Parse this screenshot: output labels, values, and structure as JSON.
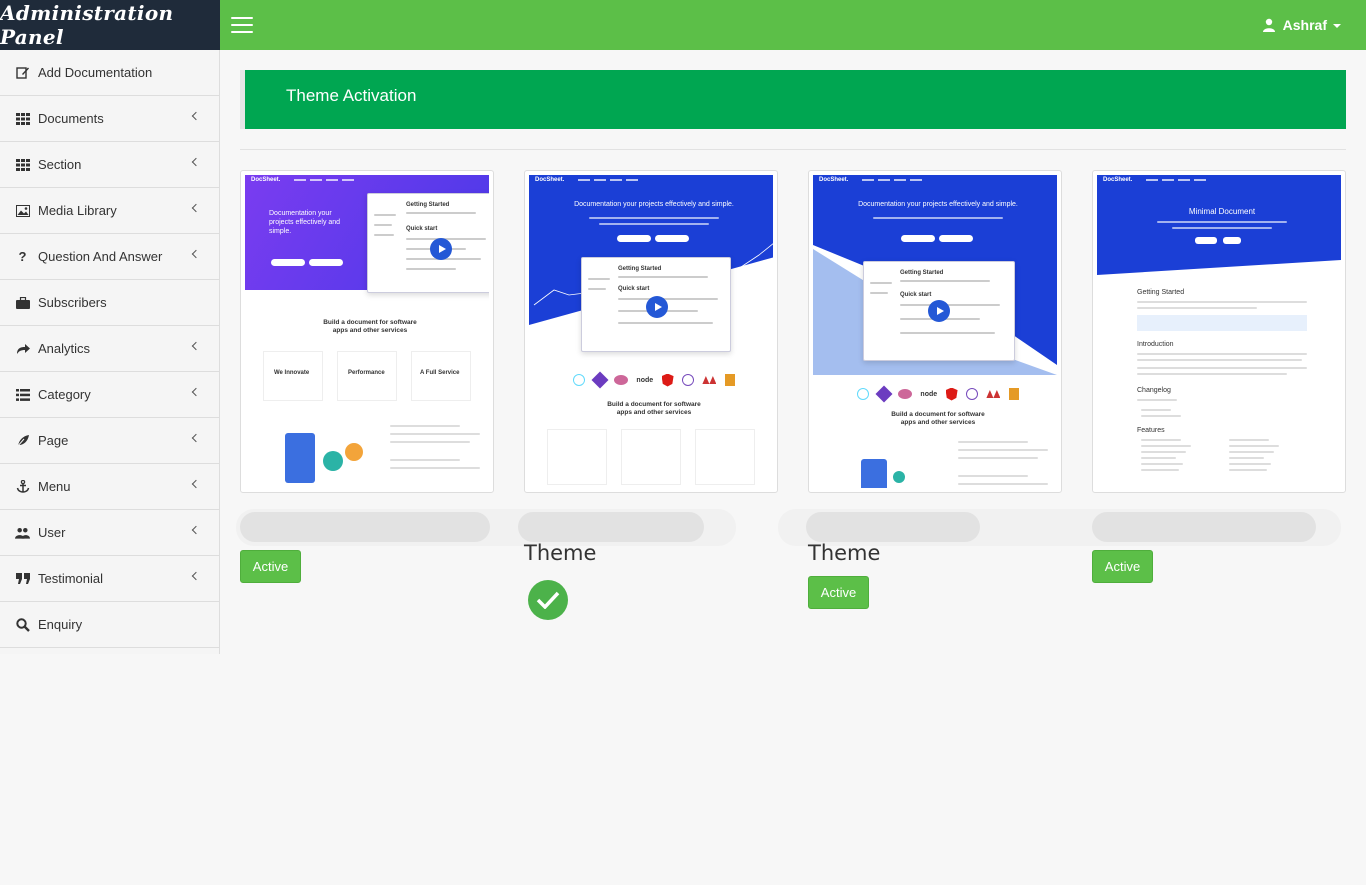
{
  "app": {
    "brand": "Administration Panel",
    "user": "Ashraf"
  },
  "sidebar": {
    "items": [
      {
        "label": "Add Documentation",
        "icon": "edit-icon",
        "submenu": false
      },
      {
        "label": "Documents",
        "icon": "grid-icon",
        "submenu": true
      },
      {
        "label": "Section",
        "icon": "grid-icon",
        "submenu": true
      },
      {
        "label": "Media Library",
        "icon": "image-icon",
        "submenu": true
      },
      {
        "label": "Question And Answer",
        "icon": "question-icon",
        "submenu": true
      },
      {
        "label": "Subscribers",
        "icon": "briefcase-icon",
        "submenu": false
      },
      {
        "label": "Analytics",
        "icon": "share-icon",
        "submenu": true
      },
      {
        "label": "Category",
        "icon": "list-icon",
        "submenu": true
      },
      {
        "label": "Page",
        "icon": "leaf-icon",
        "submenu": true
      },
      {
        "label": "Menu",
        "icon": "anchor-icon",
        "submenu": true
      },
      {
        "label": "User",
        "icon": "users-icon",
        "submenu": true
      },
      {
        "label": "Testimonial",
        "icon": "quote-icon",
        "submenu": true
      },
      {
        "label": "Enquiry",
        "icon": "search-icon",
        "submenu": false
      }
    ]
  },
  "main": {
    "title": "Theme Activation",
    "themes": [
      {
        "label": "",
        "button": "Active",
        "activated": false
      },
      {
        "label": "Theme",
        "button": "",
        "activated": true
      },
      {
        "label": "Theme",
        "button": "Active",
        "activated": false
      },
      {
        "label": "",
        "button": "Active",
        "activated": false
      }
    ],
    "thumb_text": {
      "t1_hero": "Documentation your projects effectively and simple.",
      "t1_build": "Build a document for software apps and other services",
      "t1_f1": "We Innovate",
      "t1_f2": "Performance",
      "t1_f3": "A Full Service",
      "t2_hero": "Documentation your projects effectively and simple.",
      "t2_build": "Build a document for software apps and other services",
      "t3_hero": "Documentation your projects effectively and simple.",
      "t3_build": "Build a document for software apps and other services",
      "t4_hero": "Minimal Document",
      "t4_h1": "Getting Started",
      "t4_h2": "Introduction",
      "t4_h3": "Changelog",
      "t4_h4": "Features",
      "getting_started": "Getting Started",
      "quick_start": "Quick start",
      "logo": "DocSheet."
    }
  },
  "colors": {
    "topbar": "#5cbf48",
    "brand_bg": "#1f2b3a",
    "header": "#00a651",
    "active_btn": "#5cbf48",
    "hero_blue": "#1b3fd6",
    "hero_purple": "#6c3cf0"
  }
}
